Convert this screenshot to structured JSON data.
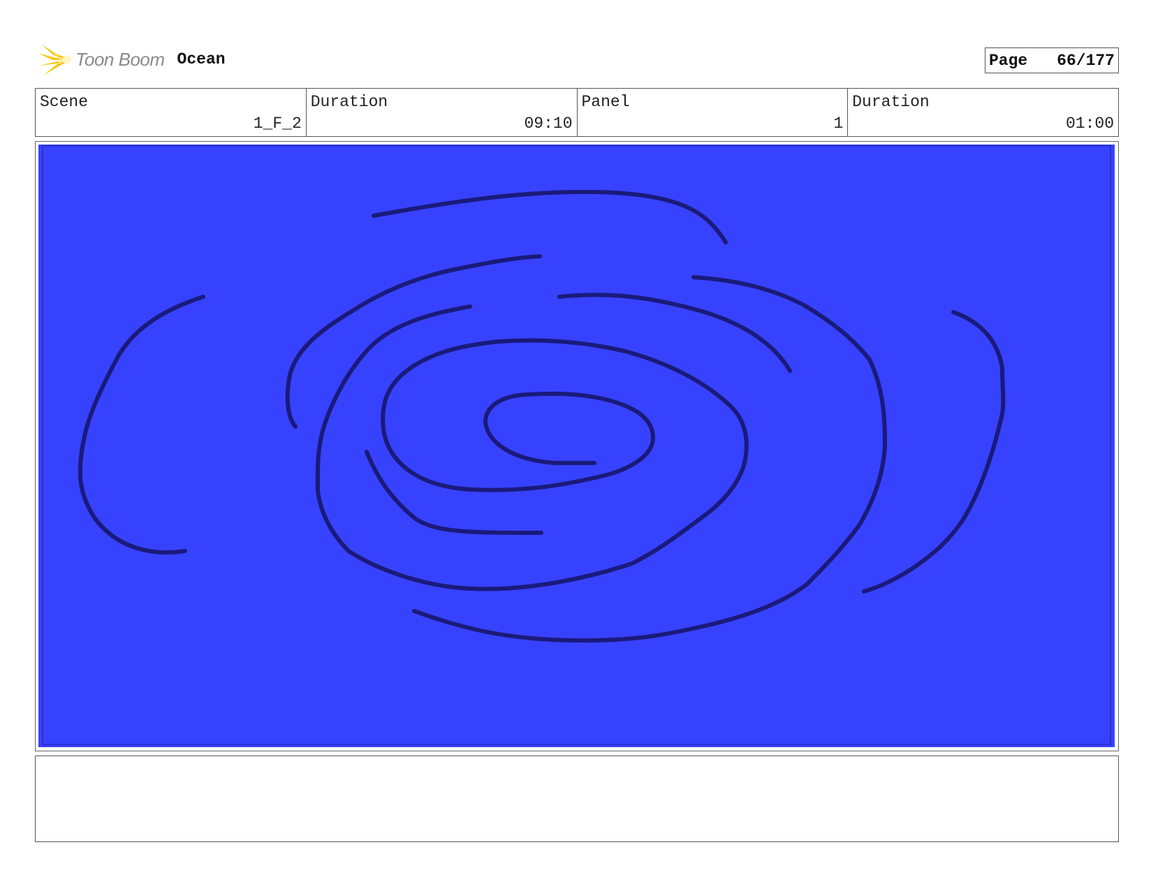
{
  "header": {
    "logo_text": "Toon Boom",
    "project_title": "Ocean",
    "page_label": "Page",
    "page_value": "66/177"
  },
  "info": {
    "scene_label": "Scene",
    "scene_value": "1_F_2",
    "scene_duration_label": "Duration",
    "scene_duration_value": "09:10",
    "panel_label": "Panel",
    "panel_value": "1",
    "panel_duration_label": "Duration",
    "panel_duration_value": "01:00"
  },
  "panel": {
    "background_color": "#3742ff",
    "stroke_color": "#1a1a7a"
  },
  "notes": {
    "text": ""
  }
}
